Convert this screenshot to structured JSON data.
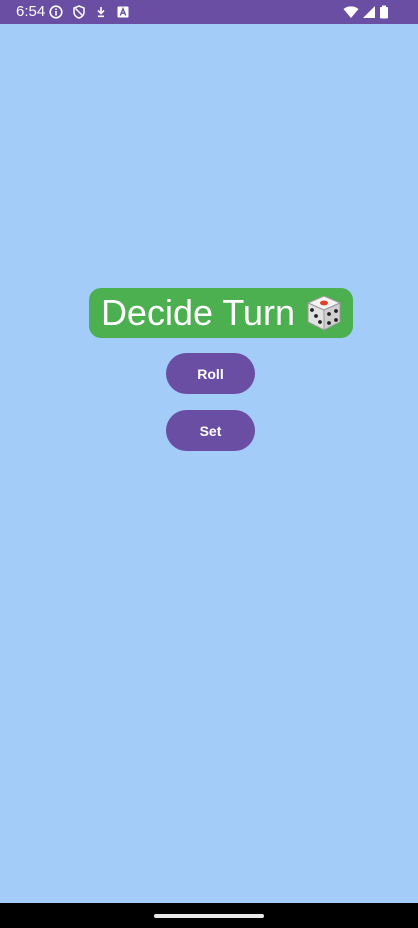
{
  "status_bar": {
    "time": "6:54",
    "left_icons": [
      "info-icon",
      "shield-icon",
      "download-icon",
      "keyboard-a-icon"
    ],
    "right_icons": [
      "wifi-icon",
      "cellular-icon",
      "battery-icon"
    ]
  },
  "main": {
    "title": "Decide Turn",
    "title_icon": "dice-icon",
    "roll_label": "Roll",
    "set_label": "Set"
  },
  "colors": {
    "background": "#a3cdf8",
    "status_bar": "#6a4ea3",
    "title_chip": "#4caf50",
    "button": "#6a4ea3",
    "nav_bar": "#000000"
  }
}
